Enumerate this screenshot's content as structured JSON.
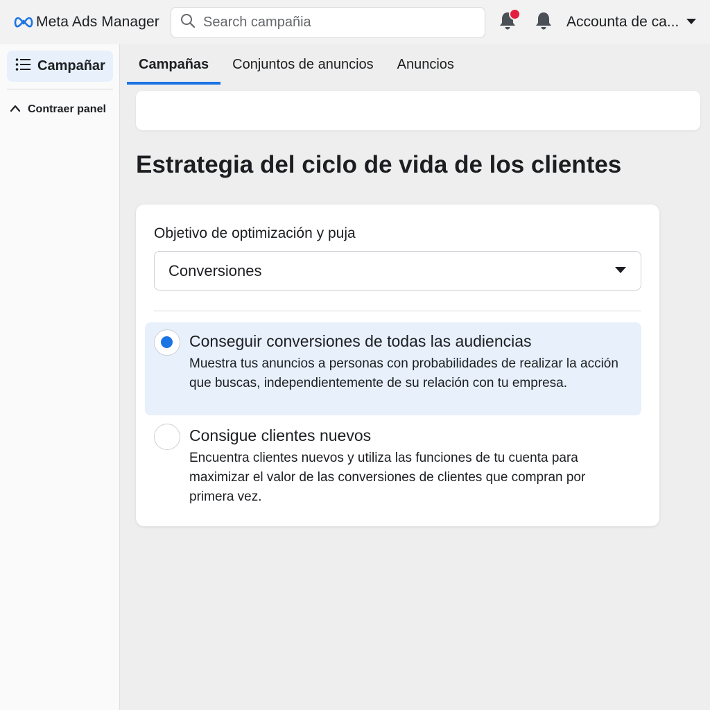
{
  "header": {
    "brand": "Meta Ads Manager",
    "search_placeholder": "Search campañia",
    "account_label": "Accounta de ca...",
    "accent": "#1b74e4",
    "notification_dot_color": "#e41e3f"
  },
  "sidebar": {
    "active_item": {
      "label": "Campañar",
      "icon": "list-icon"
    },
    "collapse_label": "Contraer panel"
  },
  "tabs": [
    {
      "label": "Campañas",
      "active": true
    },
    {
      "label": "Conjuntos de anuncios",
      "active": false
    },
    {
      "label": "Anuncios",
      "active": false
    }
  ],
  "main": {
    "section_title": "Estrategia del ciclo de vida de los clientes",
    "field_label": "Objetivo de optimización y puja",
    "select_value": "Conversiones",
    "options": [
      {
        "title": "Conseguir conversiones de todas las audiencias",
        "description": "Muestra tus anuncios a personas con probabilidades de realizar la acción que buscas, independientemente de su relación con tu empresa.",
        "selected": true
      },
      {
        "title": "Consigue clientes nuevos",
        "description": "Encuentra clientes nuevos y utiliza las funciones de tu cuenta para maximizar el valor de las conversiones de clientes que compran por primera vez.",
        "selected": false
      }
    ]
  }
}
